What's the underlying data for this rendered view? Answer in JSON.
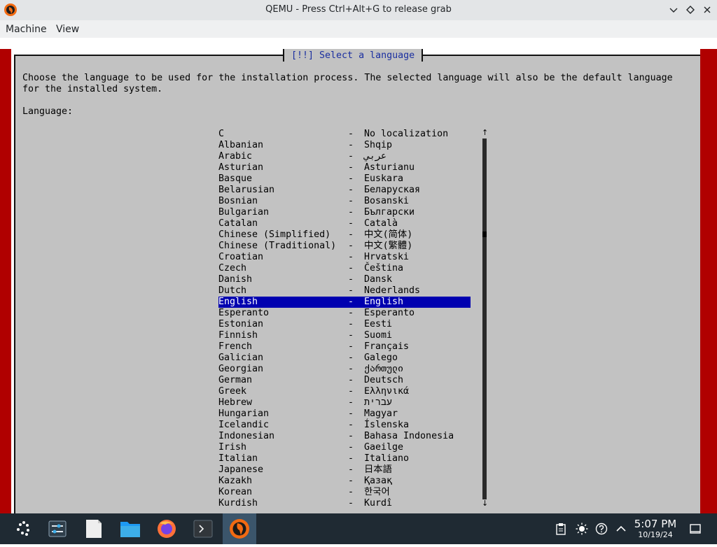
{
  "window": {
    "title": "QEMU - Press Ctrl+Alt+G to release grab",
    "controls": [
      "minimize-icon",
      "maximize-icon",
      "close-icon"
    ]
  },
  "menubar": {
    "items": [
      "Machine",
      "View"
    ]
  },
  "installer": {
    "dialog_title": "[!!] Select a language",
    "description": "Choose the language to be used for the installation process. The selected language will also be the default language\nfor the installed system.",
    "list_label": "Language:",
    "separator": "-",
    "selected": "English",
    "languages": [
      {
        "name": "C",
        "native": "No localization"
      },
      {
        "name": "Albanian",
        "native": "Shqip"
      },
      {
        "name": "Arabic",
        "native": "عربي"
      },
      {
        "name": "Asturian",
        "native": "Asturianu"
      },
      {
        "name": "Basque",
        "native": "Euskara"
      },
      {
        "name": "Belarusian",
        "native": "Беларуская"
      },
      {
        "name": "Bosnian",
        "native": "Bosanski"
      },
      {
        "name": "Bulgarian",
        "native": "Български"
      },
      {
        "name": "Catalan",
        "native": "Català"
      },
      {
        "name": "Chinese (Simplified)",
        "native": "中文(简体)"
      },
      {
        "name": "Chinese (Traditional)",
        "native": "中文(繁體)"
      },
      {
        "name": "Croatian",
        "native": "Hrvatski"
      },
      {
        "name": "Czech",
        "native": "Čeština"
      },
      {
        "name": "Danish",
        "native": "Dansk"
      },
      {
        "name": "Dutch",
        "native": "Nederlands"
      },
      {
        "name": "English",
        "native": "English"
      },
      {
        "name": "Esperanto",
        "native": "Esperanto"
      },
      {
        "name": "Estonian",
        "native": "Eesti"
      },
      {
        "name": "Finnish",
        "native": "Suomi"
      },
      {
        "name": "French",
        "native": "Français"
      },
      {
        "name": "Galician",
        "native": "Galego"
      },
      {
        "name": "Georgian",
        "native": "ქართული"
      },
      {
        "name": "German",
        "native": "Deutsch"
      },
      {
        "name": "Greek",
        "native": "Ελληνικά"
      },
      {
        "name": "Hebrew",
        "native": "עברית"
      },
      {
        "name": "Hungarian",
        "native": "Magyar"
      },
      {
        "name": "Icelandic",
        "native": "Íslenska"
      },
      {
        "name": "Indonesian",
        "native": "Bahasa Indonesia"
      },
      {
        "name": "Irish",
        "native": "Gaeilge"
      },
      {
        "name": "Italian",
        "native": "Italiano"
      },
      {
        "name": "Japanese",
        "native": "日本語"
      },
      {
        "name": "Kazakh",
        "native": "Қазақ"
      },
      {
        "name": "Korean",
        "native": "한국어"
      },
      {
        "name": "Kurdish",
        "native": "Kurdî"
      }
    ]
  },
  "taskbar": {
    "launchers": [
      "application-launcher-icon",
      "system-settings-icon",
      "document-icon",
      "folder-icon",
      "firefox-icon",
      "terminal-icon",
      "qemu-icon"
    ],
    "tray": [
      "clipboard-icon",
      "brightness-icon",
      "help-icon",
      "chevron-up-icon"
    ],
    "clock_time": "5:07 PM",
    "clock_date": "10/19/24"
  },
  "colors": {
    "selection_bg": "#0000b0",
    "title_blue": "#1b2fa0",
    "frame_red": "#b00000",
    "panel_gray": "#c2c2c2",
    "taskbar_bg": "#1f2a33"
  }
}
